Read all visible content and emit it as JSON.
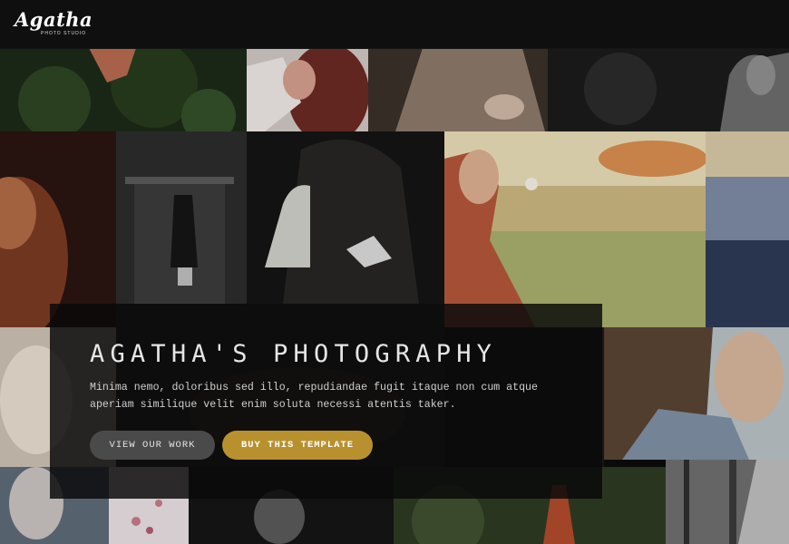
{
  "brand": {
    "logo_text": "Agatha",
    "logo_subtitle": "PHOTO STUDIO"
  },
  "hero": {
    "title": "AGATHA'S PHOTOGRAPHY",
    "description": "Minima nemo, doloribus sed illo, repudiandae fugit itaque non cum atque aperiam similique velit enim soluta necessi atentis taker.",
    "buttons": {
      "view_work": "VIEW OUR WORK",
      "buy_template": "BUY THIS TEMPLATE"
    }
  },
  "colors": {
    "topbar": "#0f0f0f",
    "accent": "#b8912e",
    "secondary_button": "#4a4a4a"
  },
  "gallery": {
    "photo_count": 18
  }
}
